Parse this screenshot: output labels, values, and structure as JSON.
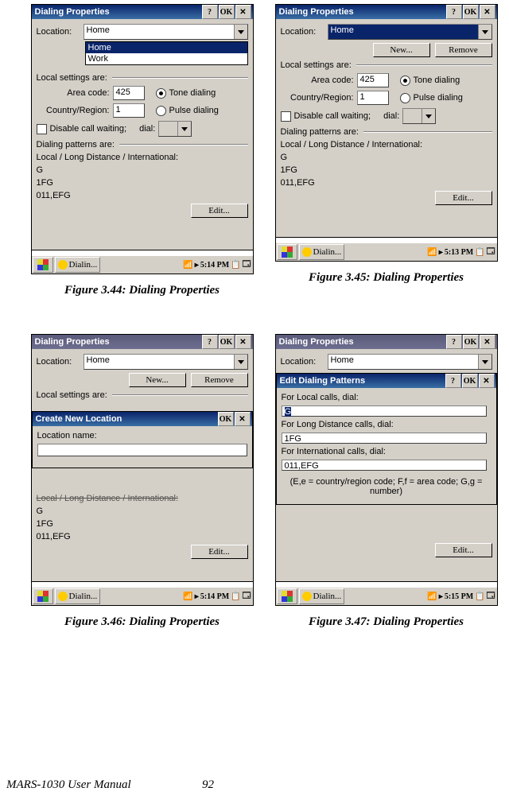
{
  "figs": [
    {
      "cap": "Figure 3.44: Dialing Properties",
      "title": "Dialing Properties",
      "loc_lbl": "Location:",
      "loc_val": "Home",
      "drop": [
        "Home",
        "Work"
      ],
      "local_settings": "Local settings are:",
      "ac_lbl": "Area code:",
      "ac_val": "425",
      "cr_lbl": "Country/Region:",
      "cr_val": "1",
      "tone": "Tone dialing",
      "pulse": "Pulse dialing",
      "disable": "Disable call waiting;",
      "dial": "dial:",
      "pat_hdr": "Dialing patterns are:",
      "pat_sub": "Local / Long Distance / International:",
      "p1": "G",
      "p2": "1FG",
      "p3": "011,EFG",
      "edit": "Edit...",
      "time": "5:14 PM",
      "task": "Dialin..."
    },
    {
      "cap": "Figure 3.45: Dialing Properties",
      "title": "Dialing Properties",
      "loc_lbl": "Location:",
      "loc_val": "Home",
      "new": "New...",
      "remove": "Remove",
      "local_settings": "Local settings are:",
      "ac_lbl": "Area code:",
      "ac_val": "425",
      "cr_lbl": "Country/Region:",
      "cr_val": "1",
      "tone": "Tone dialing",
      "pulse": "Pulse dialing",
      "disable": "Disable call waiting;",
      "dial": "dial:",
      "pat_hdr": "Dialing patterns are:",
      "pat_sub": "Local / Long Distance / International:",
      "p1": "G",
      "p2": "1FG",
      "p3": "011,EFG",
      "edit": "Edit...",
      "time": "5:13 PM",
      "task": "Dialin..."
    },
    {
      "cap": "Figure 3.46: Dialing Properties",
      "title": "Dialing Properties",
      "loc_lbl": "Location:",
      "loc_val": "Home",
      "new": "New...",
      "remove": "Remove",
      "local_settings": "Local settings are:",
      "modal_title": "Create New Location",
      "modal_lbl": "Location name:",
      "p1": "G",
      "p2": "1FG",
      "p3": "011,EFG",
      "pat_sub_cut": "Local / Long Distance / International:",
      "edit": "Edit...",
      "time": "5:14 PM",
      "task": "Dialin..."
    },
    {
      "cap": "Figure 3.47: Dialing Properties",
      "title": "Dialing Properties",
      "loc_lbl": "Location:",
      "loc_val": "Home",
      "modal_title": "Edit Dialing Patterns",
      "l1": "For Local calls, dial:",
      "v1": "G",
      "l2": "For Long Distance calls, dial:",
      "v2": "1FG",
      "l3": "For International calls, dial:",
      "v3": "011,EFG",
      "hint": "(E,e = country/region code; F,f = area code; G,g = number)",
      "edit": "Edit...",
      "time": "5:15 PM",
      "task": "Dialin..."
    }
  ],
  "btn": {
    "help": "?",
    "ok": "OK",
    "close": "✕",
    "arrow": "▸"
  },
  "footer": {
    "manual": "MARS-1030 User Manual",
    "page": "92"
  }
}
